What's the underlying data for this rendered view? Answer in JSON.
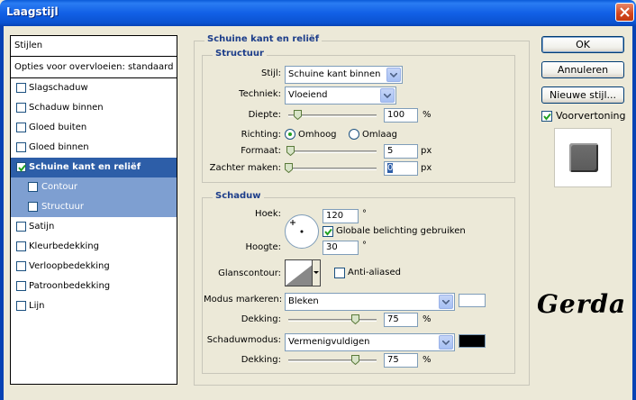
{
  "window": {
    "title": "Laagstijl"
  },
  "left_panel": {
    "header_stijlen": "Stijlen",
    "header_opties": "Opties voor overvloeien: standaard",
    "items": [
      {
        "label": "Slagschaduw",
        "checked": false
      },
      {
        "label": "Schaduw binnen",
        "checked": false
      },
      {
        "label": "Gloed buiten",
        "checked": false
      },
      {
        "label": "Gloed binnen",
        "checked": false
      },
      {
        "label": "Schuine kant en reliëf",
        "checked": true,
        "selected": true
      },
      {
        "label": "Contour",
        "checked": false,
        "sub": true
      },
      {
        "label": "Structuur",
        "checked": false,
        "sub": true
      },
      {
        "label": "Satijn",
        "checked": false
      },
      {
        "label": "Kleurbedekking",
        "checked": false
      },
      {
        "label": "Verloopbedekking",
        "checked": false
      },
      {
        "label": "Patroonbedekking",
        "checked": false
      },
      {
        "label": "Lijn",
        "checked": false
      }
    ]
  },
  "bevel": {
    "group_title": "Schuine kant en reliëf",
    "structure": {
      "title": "Structuur",
      "stijl_label": "Stijl:",
      "stijl_value": "Schuine kant binnen",
      "techniek_label": "Techniek:",
      "techniek_value": "Vloeiend",
      "diepte_label": "Diepte:",
      "diepte_value": "100",
      "diepte_unit": "%",
      "diepte_level": 0.1,
      "richting_label": "Richting:",
      "richting_up": "Omhoog",
      "richting_down": "Omlaag",
      "richting_selected": "up",
      "formaat_label": "Formaat:",
      "formaat_value": "5",
      "formaat_unit": "px",
      "formaat_level": 0.02,
      "zachter_label": "Zachter maken:",
      "zachter_value": "0",
      "zachter_unit": "px",
      "zachter_level": 0
    },
    "shadow": {
      "title": "Schaduw",
      "hoek_label": "Hoek:",
      "hoek_value": "120",
      "hoek_unit": "°",
      "global_light_label": "Globale belichting gebruiken",
      "global_light_checked": true,
      "hoogte_label": "Hoogte:",
      "hoogte_value": "30",
      "hoogte_unit": "°",
      "glans_label": "Glanscontour:",
      "anti_aliased_label": "Anti-aliased",
      "anti_aliased_checked": false,
      "modus_markeren_label": "Modus markeren:",
      "modus_markeren_value": "Bleken",
      "highlight_color": "#ffffff",
      "dekking1_label": "Dekking:",
      "dekking1_value": "75",
      "dekking1_unit": "%",
      "dekking1_level": 0.75,
      "schaduwmodus_label": "Schaduwmodus:",
      "schaduwmodus_value": "Vermenigvuldigen",
      "shadow_color": "#000000",
      "dekking2_label": "Dekking:",
      "dekking2_value": "75",
      "dekking2_unit": "%",
      "dekking2_level": 0.75
    }
  },
  "buttons": {
    "ok": "OK",
    "cancel": "Annuleren",
    "new_style": "Nieuwe stijl...",
    "preview_label": "Voorvertoning",
    "preview_checked": true
  },
  "logo": "Gerda"
}
